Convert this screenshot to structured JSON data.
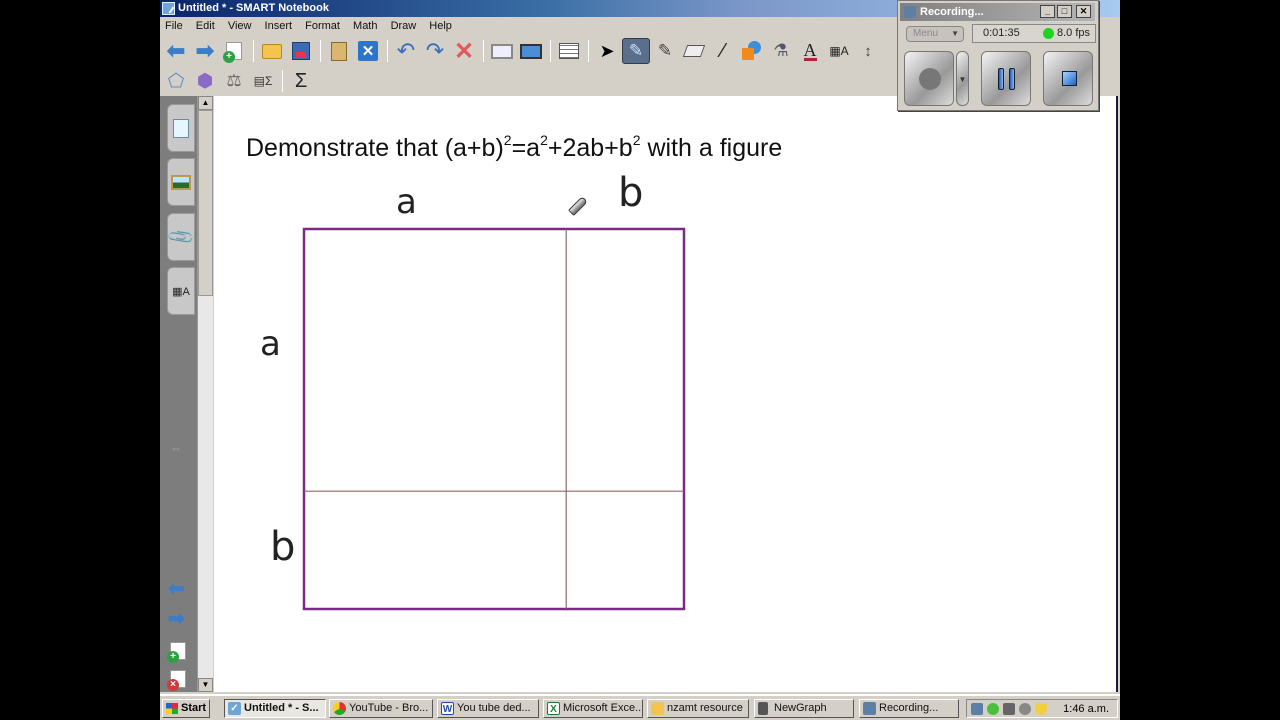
{
  "window": {
    "title": "Untitled * - SMART Notebook"
  },
  "menu": [
    "File",
    "Edit",
    "View",
    "Insert",
    "Format",
    "Math",
    "Draw",
    "Help"
  ],
  "toolbar": {
    "row1": [
      {
        "name": "previous-page-icon",
        "glyph": "⬅"
      },
      {
        "name": "next-page-icon",
        "glyph": "➡"
      },
      {
        "name": "add-page-icon",
        "glyph": ""
      },
      {
        "name": "open-file-icon",
        "glyph": ""
      },
      {
        "name": "save-icon",
        "glyph": ""
      },
      {
        "name": "paste-icon",
        "glyph": ""
      },
      {
        "name": "full-screen-x-icon",
        "glyph": "✕"
      },
      {
        "name": "undo-icon",
        "glyph": "↶"
      },
      {
        "name": "redo-icon",
        "glyph": "↷"
      },
      {
        "name": "delete-icon",
        "glyph": "✕"
      },
      {
        "name": "screen-shade-icon",
        "glyph": ""
      },
      {
        "name": "display-icon",
        "glyph": ""
      },
      {
        "name": "table-icon",
        "glyph": ""
      },
      {
        "name": "select-icon",
        "glyph": "➤"
      },
      {
        "name": "pen-icon",
        "glyph": "✎"
      },
      {
        "name": "creative-pen-icon",
        "glyph": "✎"
      },
      {
        "name": "eraser-icon",
        "glyph": ""
      },
      {
        "name": "line-icon",
        "glyph": "⁄"
      },
      {
        "name": "shapes-icon",
        "glyph": ""
      },
      {
        "name": "fill-icon",
        "glyph": "⚗"
      },
      {
        "name": "text-icon",
        "glyph": "A"
      },
      {
        "name": "properties-icon",
        "glyph": "▦A"
      },
      {
        "name": "move-toolbar-icon",
        "glyph": "↕"
      }
    ],
    "row2": [
      {
        "name": "polygon-icon",
        "glyph": "⬠"
      },
      {
        "name": "shape-recognition-icon",
        "glyph": "⬢"
      },
      {
        "name": "compass-icon",
        "glyph": "⚖"
      },
      {
        "name": "table-sum-icon",
        "glyph": "▤Σ"
      },
      {
        "name": "sigma-icon",
        "glyph": "Σ"
      }
    ],
    "active_tool": "pen-icon"
  },
  "canvas": {
    "heading": {
      "prefix": "Demonstrate that (a+b)",
      "sup1": "2",
      "mid1": "=a",
      "sup2": "2",
      "mid2": "+2ab+b",
      "sup3": "2",
      "suffix": " with a figure"
    },
    "labels": {
      "top_a": "a",
      "top_b": "b",
      "left_a": "a",
      "left_b": "b"
    },
    "figure": {
      "outer_color": "#7a2a82",
      "inner_color": "#8a6a6a",
      "a_fraction": 0.69
    }
  },
  "recorder": {
    "title": "Recording...",
    "menu_label": "Menu",
    "elapsed": "0:01:35",
    "fps": "8.0 fps",
    "status_color": "#1fd41f"
  },
  "taskbar": {
    "start": "Start",
    "tasks": [
      {
        "label": "Untitled * - S...",
        "icon": "smart",
        "active": true
      },
      {
        "label": "YouTube - Bro...",
        "icon": "chrome",
        "active": false
      },
      {
        "label": "You tube ded...",
        "icon": "word",
        "active": false
      },
      {
        "label": "Microsoft Exce...",
        "icon": "excel",
        "active": false
      },
      {
        "label": "nzamt resource",
        "icon": "folder",
        "active": false
      },
      {
        "label": "NewGraph",
        "icon": "calculator",
        "active": false
      },
      {
        "label": "Recording...",
        "icon": "recorder",
        "active": false
      }
    ],
    "clock": "1:46 a.m."
  }
}
